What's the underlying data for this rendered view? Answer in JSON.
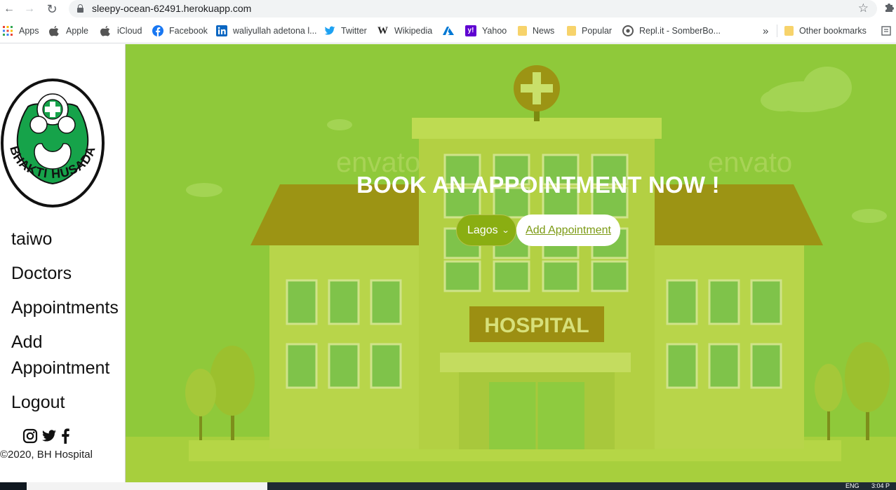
{
  "browser": {
    "url": "sleepy-ocean-62491.herokuapp.com",
    "bookmarks": [
      {
        "label": "Apps",
        "icon": "apps-grid-icon"
      },
      {
        "label": "Apple",
        "icon": "apple-icon"
      },
      {
        "label": "iCloud",
        "icon": "apple-icon"
      },
      {
        "label": "Facebook",
        "icon": "facebook-icon"
      },
      {
        "label": "waliyullah adetona l...",
        "icon": "linkedin-icon"
      },
      {
        "label": "Twitter",
        "icon": "twitter-icon"
      },
      {
        "label": "Wikipedia",
        "icon": "wikipedia-icon"
      },
      {
        "label": "",
        "icon": "azure-icon"
      },
      {
        "label": "Yahoo",
        "icon": "yahoo-icon"
      },
      {
        "label": "News",
        "icon": "folder-icon"
      },
      {
        "label": "Popular",
        "icon": "folder-icon"
      },
      {
        "label": "Repl.it - SomberBo...",
        "icon": "replit-icon"
      }
    ],
    "overflow": "»",
    "other_bookmarks": "Other bookmarks"
  },
  "sidebar": {
    "logo_text": "BHAKTI HUSADA",
    "menu": [
      {
        "label": "taiwo"
      },
      {
        "label": "Doctors"
      },
      {
        "label": "Appointments"
      },
      {
        "label": "Add Appointment"
      },
      {
        "label": "Logout"
      }
    ],
    "copyright": "©2020, BH Hospital"
  },
  "hero": {
    "title": "BOOK AN APPOINTMENT NOW !",
    "city_select": {
      "selected": "Lagos"
    },
    "add_button": "Add Appointment",
    "sign_text": "HOSPITAL",
    "watermark": "envato"
  },
  "taskbar": {
    "language": "ENG",
    "time": "3:04 P"
  },
  "colors": {
    "hero_bg": "#8fc93a",
    "select_bg": "#8aae12",
    "button_text": "#7c9a14",
    "logo_green": "#16a34a"
  }
}
